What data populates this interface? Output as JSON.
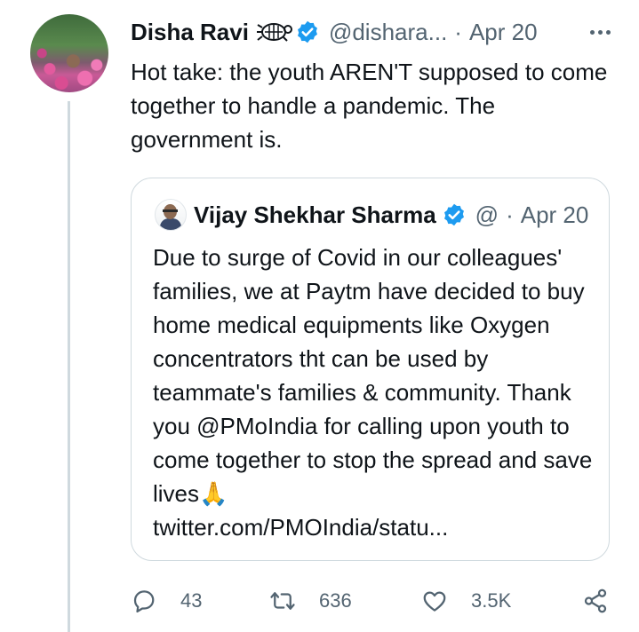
{
  "tweet": {
    "author_name": "Disha Ravi",
    "author_handle": "@dishara...",
    "separator": "·",
    "date": "Apr 20",
    "text": "Hot take: the youth AREN'T supposed to come together to handle a pandemic.  The government is."
  },
  "quoted_tweet": {
    "author_name": "Vijay Shekhar Sharma",
    "author_handle": "@",
    "separator": "·",
    "date": "Apr 20",
    "text": "Due to surge of Covid in our colleagues' families, we at Paytm have decided to buy home medical equipments like Oxygen concentrators tht can be used by teammate's families & community. Thank you @PMoIndia for calling upon youth to come together to stop the spread and save lives",
    "emoji": "🙏",
    "link": "twitter.com/PMOIndia/statu..."
  },
  "actions": {
    "replies": "43",
    "retweets": "636",
    "likes": "3.5K"
  },
  "icons": {
    "reply": "reply-bubble-icon",
    "retweet": "retweet-icon",
    "like": "heart-icon",
    "share": "share-icon",
    "more": "more-dots-icon",
    "verified": "verified-badge-icon",
    "turtle": "turtle-emoji-icon"
  },
  "colors": {
    "verified_blue": "#1d9bf0",
    "secondary_text": "#536471",
    "border": "#cfd9de"
  }
}
